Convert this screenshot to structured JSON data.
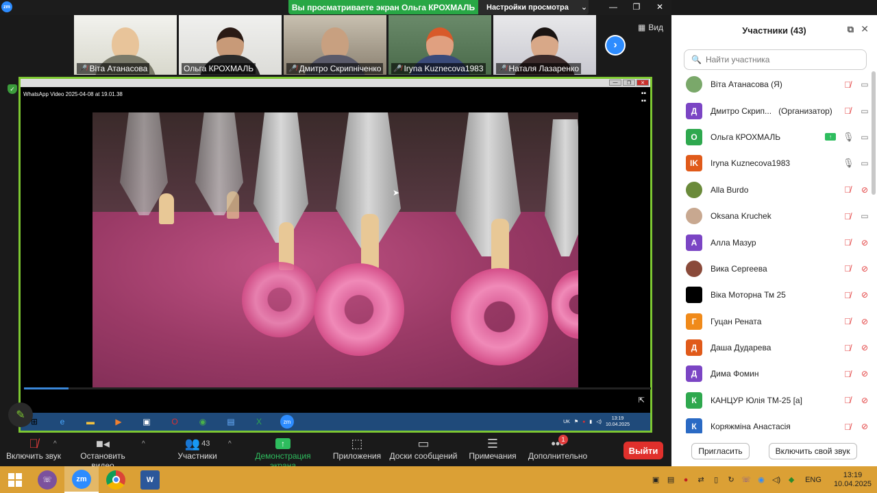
{
  "window": {
    "share_banner": "Вы просматриваете экран Ольга КРОХМАЛЬ",
    "view_options": "Настройки просмотра",
    "logo": "zm"
  },
  "gallery": {
    "view_label": "Вид",
    "thumbnails": [
      {
        "name": "Віта Атанасова",
        "muted": true
      },
      {
        "name": "Ольга КРОХМАЛЬ",
        "muted": false
      },
      {
        "name": "Дмитро Скрипніченко",
        "muted": true
      },
      {
        "name": "Iryna Kuznecova1983",
        "muted": true
      },
      {
        "name": "Наталя Лазаренко",
        "muted": true
      }
    ]
  },
  "shared_screen": {
    "player_title": "WhatsApp Video 2025-04-08 at 19.01.38",
    "inner_tray": {
      "lang": "UK",
      "time": "13:19",
      "date": "10.04.2025"
    }
  },
  "toolbar": {
    "audio": "Включить звук",
    "video": "Остановить видео",
    "participants": "Участники",
    "participants_count": "43",
    "share": "Демонстрация экрана",
    "apps": "Приложения",
    "whiteboards": "Доски сообщений",
    "notes": "Примечания",
    "more": "Дополнительно",
    "more_badge": "1",
    "leave": "Выйти"
  },
  "panel": {
    "title": "Участники (43)",
    "search_placeholder": "Найти участника",
    "participants": [
      {
        "name": "Віта Атанасова (Я)",
        "role": "",
        "avatar": "",
        "color": "#7aa86a",
        "photo": true,
        "mic": "off",
        "cam": "on",
        "sharing": false
      },
      {
        "name": "Дмитро Скрип...",
        "role": "(Организатор)",
        "avatar": "Д",
        "color": "#7b45c4",
        "photo": false,
        "mic": "off",
        "cam": "on",
        "sharing": false
      },
      {
        "name": "Ольга КРОХМАЛЬ",
        "role": "",
        "avatar": "О",
        "color": "#2ea84e",
        "photo": false,
        "mic": "on",
        "cam": "on",
        "sharing": true
      },
      {
        "name": "Iryna Kuznecova1983",
        "role": "",
        "avatar": "IK",
        "color": "#e05a1a",
        "photo": false,
        "mic": "on",
        "cam": "on",
        "sharing": false
      },
      {
        "name": "Alla Burdo",
        "role": "",
        "avatar": "",
        "color": "#6a8a3a",
        "photo": true,
        "mic": "off",
        "cam": "off",
        "sharing": false
      },
      {
        "name": "Oksana Kruchek",
        "role": "",
        "avatar": "",
        "color": "#c8a890",
        "photo": true,
        "mic": "off",
        "cam": "on",
        "sharing": false
      },
      {
        "name": "Алла Мазур",
        "role": "",
        "avatar": "А",
        "color": "#7b45c4",
        "photo": false,
        "mic": "off",
        "cam": "off",
        "sharing": false
      },
      {
        "name": "Вика Сергеева",
        "role": "",
        "avatar": "",
        "color": "#8a4a3a",
        "photo": true,
        "mic": "off",
        "cam": "off",
        "sharing": false
      },
      {
        "name": "Віка Моторна Тм 25",
        "role": "",
        "avatar": "",
        "color": "#000000",
        "photo": false,
        "mic": "off",
        "cam": "off",
        "sharing": false
      },
      {
        "name": "Гуцан Рената",
        "role": "",
        "avatar": "Г",
        "color": "#f08a1a",
        "photo": false,
        "mic": "off",
        "cam": "off",
        "sharing": false
      },
      {
        "name": "Даша Дударева",
        "role": "",
        "avatar": "Д",
        "color": "#e05a1a",
        "photo": false,
        "mic": "off",
        "cam": "off",
        "sharing": false
      },
      {
        "name": "Дима Фомин",
        "role": "",
        "avatar": "Д",
        "color": "#7b45c4",
        "photo": false,
        "mic": "off",
        "cam": "off",
        "sharing": false
      },
      {
        "name": "КАНЦУР Юлія ТМ-25 [а]",
        "role": "",
        "avatar": "К",
        "color": "#2ea84e",
        "photo": false,
        "mic": "off",
        "cam": "off",
        "sharing": false
      },
      {
        "name": "Коряжміна Анастасія",
        "role": "",
        "avatar": "К",
        "color": "#2a6ac4",
        "photo": false,
        "mic": "off",
        "cam": "off",
        "sharing": false
      }
    ],
    "invite": "Пригласить",
    "unmute_me": "Включить свой звук"
  },
  "taskbar": {
    "lang": "ENG",
    "time": "13:19",
    "date": "10.04.2025",
    "zoom_label": "zm"
  }
}
